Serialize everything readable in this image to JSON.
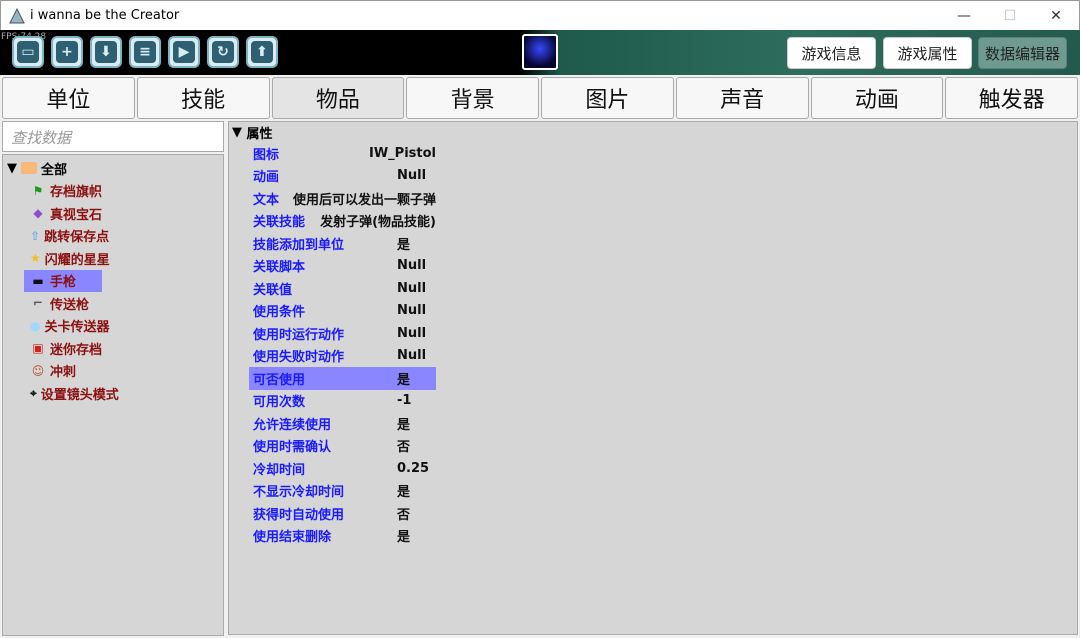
{
  "window": {
    "title": "i wanna be the Creator",
    "minimize": "—",
    "maximize": "☐",
    "close": "✕"
  },
  "toolbar": {
    "fps": "FPS:74.28",
    "buttons": [
      {
        "icon": "folder-icon",
        "glyph": "▭"
      },
      {
        "icon": "new-file-icon",
        "glyph": "+"
      },
      {
        "icon": "download-icon",
        "glyph": "⬇"
      },
      {
        "icon": "save-icon",
        "glyph": "≡"
      },
      {
        "icon": "play-icon",
        "glyph": "▶"
      },
      {
        "icon": "refresh-icon",
        "glyph": "↻"
      },
      {
        "icon": "upload-icon",
        "glyph": "⬆"
      }
    ],
    "game_info": "游戏信息",
    "game_props": "游戏属性",
    "data_editor": "数据编辑器"
  },
  "tabs": [
    "单位",
    "技能",
    "物品",
    "背景",
    "图片",
    "声音",
    "动画",
    "触发器"
  ],
  "active_tab": "物品",
  "search": {
    "placeholder": "查找数据"
  },
  "tree": {
    "root": "全部",
    "items": [
      {
        "label": "存档旗帜",
        "icon": "flag-icon",
        "glyph": "⚑",
        "color": "#1a9a1a"
      },
      {
        "label": "真视宝石",
        "icon": "gem-icon",
        "glyph": "◆",
        "color": "#8a4fd0"
      },
      {
        "label": "跳转保存点",
        "icon": "arrow-up-icon",
        "glyph": "⇧",
        "color": "#6aaee0"
      },
      {
        "label": "闪耀的星星",
        "icon": "star-icon",
        "glyph": "★",
        "color": "#f0c020"
      },
      {
        "label": "手枪",
        "icon": "pistol-icon",
        "glyph": "▬",
        "color": "#111",
        "selected": true
      },
      {
        "label": "传送枪",
        "icon": "portal-gun-icon",
        "glyph": "⌐",
        "color": "#555"
      },
      {
        "label": "关卡传送器",
        "icon": "orb-icon",
        "glyph": "●",
        "color": "#9fd8ff"
      },
      {
        "label": "迷你存档",
        "icon": "mini-save-icon",
        "glyph": "▣",
        "color": "#d02020"
      },
      {
        "label": "冲刺",
        "icon": "dash-icon",
        "glyph": "☺",
        "color": "#b05030"
      },
      {
        "label": "设置镜头模式",
        "icon": "camera-icon",
        "glyph": "⌖",
        "color": "#111"
      }
    ]
  },
  "properties": {
    "section": "属性",
    "rows": [
      {
        "key": "图标",
        "value": "IW_Pistol"
      },
      {
        "key": "动画",
        "value": "Null"
      },
      {
        "key": "文本",
        "value": "使用后可以发出一颗子弹"
      },
      {
        "key": "关联技能",
        "value": "发射子弹(物品技能)"
      },
      {
        "key": "技能添加到单位",
        "value": "是"
      },
      {
        "key": "关联脚本",
        "value": "Null"
      },
      {
        "key": "关联值",
        "value": "Null"
      },
      {
        "key": "使用条件",
        "value": "Null"
      },
      {
        "key": "使用时运行动作",
        "value": "Null"
      },
      {
        "key": "使用失败时动作",
        "value": "Null"
      },
      {
        "key": "可否使用",
        "value": "是",
        "selected": true
      },
      {
        "key": "可用次数",
        "value": "-1"
      },
      {
        "key": "允许连续使用",
        "value": "是"
      },
      {
        "key": "使用时需确认",
        "value": "否"
      },
      {
        "key": "冷却时间",
        "value": "0.25"
      },
      {
        "key": "不显示冷却时间",
        "value": "是"
      },
      {
        "key": "获得时自动使用",
        "value": "否"
      },
      {
        "key": "使用结束删除",
        "value": "是"
      }
    ]
  }
}
